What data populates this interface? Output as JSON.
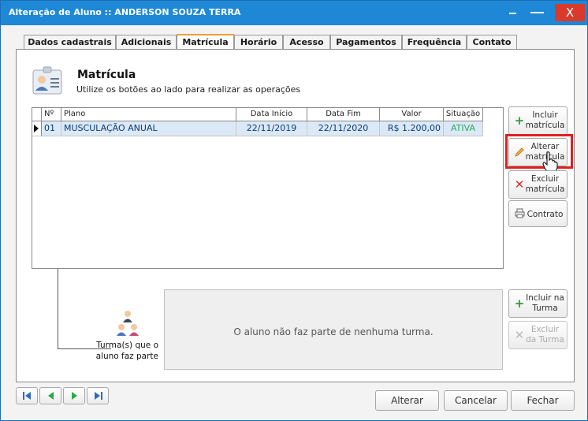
{
  "window": {
    "title": "Alteração de Aluno :: ANDERSON SOUZA TERRA",
    "min_icon": "minimize-icon",
    "max_icon": "maximize-icon",
    "close_label": "X"
  },
  "tabs": [
    {
      "label": "Dados cadastrais",
      "active": false
    },
    {
      "label": "Adicionais",
      "active": false
    },
    {
      "label": "Matrícula",
      "active": true
    },
    {
      "label": "Horário",
      "active": false
    },
    {
      "label": "Acesso",
      "active": false
    },
    {
      "label": "Pagamentos",
      "active": false
    },
    {
      "label": "Frequência",
      "active": false
    },
    {
      "label": "Contato",
      "active": false
    }
  ],
  "header": {
    "title": "Matrícula",
    "subtitle": "Utilize os botões ao lado para realizar as operações"
  },
  "grid": {
    "columns": [
      "Nº",
      "Plano",
      "Data Início",
      "Data Fim",
      "Valor",
      "Situação"
    ],
    "rows": [
      {
        "numero": "01",
        "plano": "MUSCULAÇÃO ANUAL",
        "inicio": "22/11/2019",
        "fim": "22/11/2020",
        "valor": "R$ 1.200,00",
        "situacao": "ATIVA"
      }
    ]
  },
  "side_buttons": {
    "incluir_matricula": "Incluir matrícula",
    "alterar_matricula": "Alterar matrícula",
    "excluir_matricula": "Excluir matrícula",
    "contrato": "Contrato",
    "incluir_turma": "Incluir na Turma",
    "excluir_turma": "Excluir da Turma"
  },
  "turmas": {
    "label": "Turma(s) que o aluno faz parte",
    "empty_message": "O aluno não faz parte de nenhuma turma."
  },
  "footer": {
    "alterar": "Alterar",
    "cancelar": "Cancelar",
    "fechar": "Fechar"
  },
  "colors": {
    "titlebar": "#1e88d6",
    "close": "#d93a2b",
    "active_tab_accent": "#f0a030",
    "status_active": "#2aa860",
    "highlight": "#e02020"
  }
}
